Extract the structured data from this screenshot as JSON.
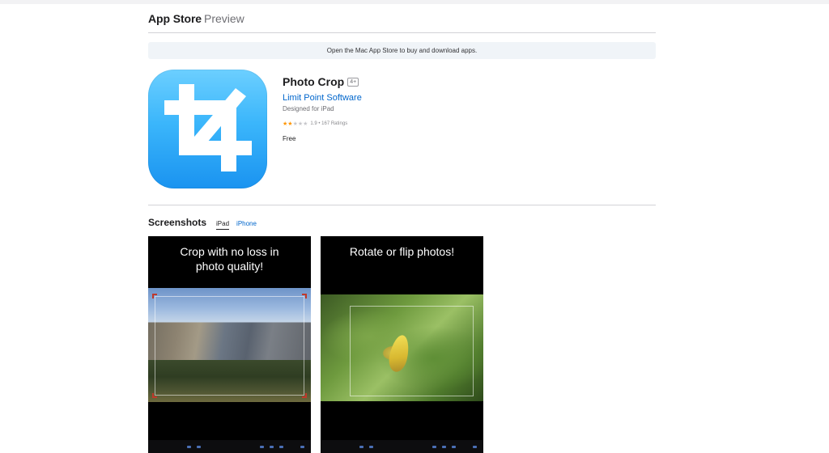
{
  "header": {
    "brand": "App Store",
    "brand_sub": "Preview"
  },
  "banner": {
    "text": "Open the Mac App Store to buy and download apps."
  },
  "app": {
    "title": "Photo Crop",
    "age_rating": "4+",
    "developer": "Limit Point Software",
    "designed_for": "Designed for iPad",
    "rating_value": 2,
    "rating_text": "1.9 • 167 Ratings",
    "price": "Free",
    "icon_name": "crop-icon",
    "icon_colors": [
      "#6ccfff",
      "#1a93f0"
    ]
  },
  "screenshots": {
    "title": "Screenshots",
    "tabs": [
      {
        "label": "iPad",
        "active": true
      },
      {
        "label": "iPhone",
        "active": false
      }
    ],
    "items": [
      {
        "caption": "Crop with no loss in photo quality!"
      },
      {
        "caption": "Rotate or flip photos!"
      }
    ]
  },
  "colors": {
    "link": "#0066cc",
    "star": "#ff9500",
    "divider": "#d2d2d7"
  }
}
